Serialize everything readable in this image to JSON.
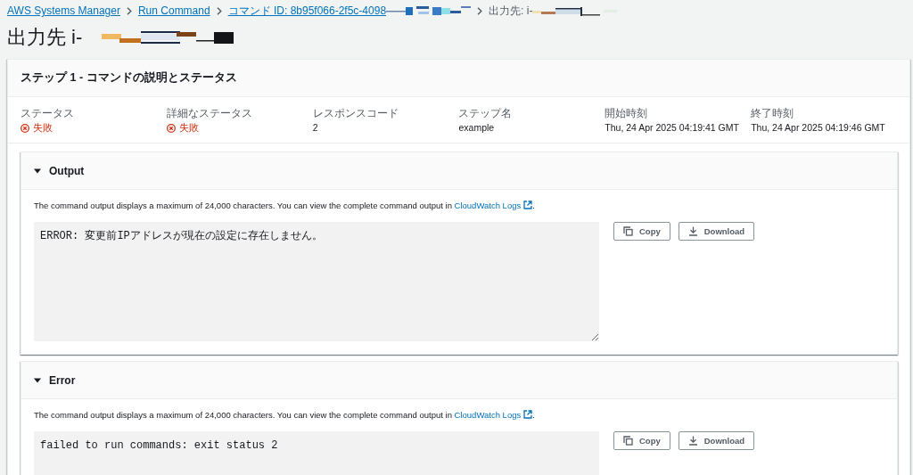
{
  "breadcrumbs": [
    {
      "text": "AWS Systems Manager",
      "kind": "link",
      "redacted": false
    },
    {
      "text": "Run Command",
      "kind": "link",
      "redacted": false
    },
    {
      "text": "コマンド ID: 8b95f066-2f5c-4098",
      "kind": "link",
      "redacted": true
    },
    {
      "text": "出力先: i-",
      "kind": "current",
      "redacted": true
    }
  ],
  "title": {
    "text": "出力先 i-",
    "redacted": true
  },
  "step": {
    "title": "ステップ 1 - コマンドの説明とステータス",
    "fields": [
      {
        "label": "ステータス",
        "value": "失敗",
        "kind": "error"
      },
      {
        "label": "詳細なステータス",
        "value": "失敗",
        "kind": "error"
      },
      {
        "label": "レスポンスコード",
        "value": "2",
        "kind": "text"
      },
      {
        "label": "ステップ名",
        "value": "example",
        "kind": "text"
      },
      {
        "label": "開始時刻",
        "value": "Thu, 24 Apr 2025 04:19:41 GMT",
        "kind": "text"
      },
      {
        "label": "終了時刻",
        "value": "Thu, 24 Apr 2025 04:19:46 GMT",
        "kind": "text"
      }
    ]
  },
  "sections": [
    {
      "title": "Output",
      "expanded": true,
      "notice": {
        "text": "The command output displays a maximum of 24,000 characters. You can view the complete command output in ",
        "link": "CloudWatch Logs",
        "end": "."
      },
      "content": "ERROR: 変更前IPアドレスが現在の設定に存在しません。",
      "buttons": [
        {
          "label": "Copy",
          "kind": "copy"
        },
        {
          "label": "Download",
          "kind": "download"
        }
      ]
    },
    {
      "title": "Error",
      "expanded": true,
      "notice": {
        "text": "The command output displays a maximum of 24,000 characters. You can view the complete command output in ",
        "link": "CloudWatch Logs",
        "end": "."
      },
      "content": "failed to run commands: exit status 2",
      "buttons": [
        {
          "label": "Copy",
          "kind": "copy"
        },
        {
          "label": "Download",
          "kind": "download"
        }
      ]
    }
  ]
}
